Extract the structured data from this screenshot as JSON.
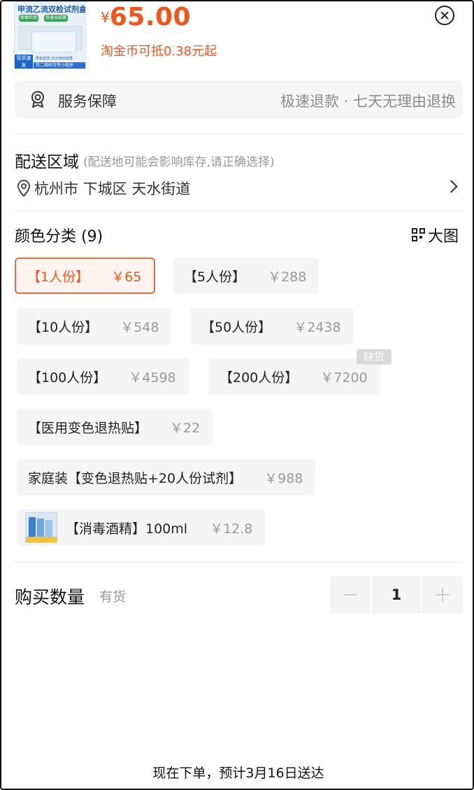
{
  "product": {
    "thumbnail_title": "甲流乙流双检试剂盒",
    "thumbnail_chips": [
      "病毒检测",
      "快速出结果"
    ],
    "thumbnail_badge": "现货速发",
    "thumbnail_strip": "带二维码可传小程序",
    "thumbnail_strip2": "居家自测 15分钟出结果",
    "currency": "¥",
    "price": "65.00",
    "coin_note": "淘金币可抵0.38元起"
  },
  "service": {
    "label": "服务保障",
    "description": "极速退款 · 七天无理由退换",
    "icon": "badge-icon"
  },
  "delivery": {
    "title": "配送区域",
    "hint": "(配送地可能会影响库存,请正确选择)",
    "address": "杭州市 下城区 天水街道",
    "icon": "location-pin-icon"
  },
  "variants": {
    "title": "颜色分类 (9)",
    "big_pic_label": "大图",
    "out_of_stock_label": "缺货",
    "options": [
      {
        "name": "【1人份】",
        "price": "￥65",
        "selected": true
      },
      {
        "name": "【5人份】",
        "price": "￥288"
      },
      {
        "name": "【10人份】",
        "price": "￥548"
      },
      {
        "name": "【50人份】",
        "price": "￥2438"
      },
      {
        "name": "【100人份】",
        "price": "￥4598"
      },
      {
        "name": "【200人份】",
        "price": "￥7200",
        "out_of_stock": true
      },
      {
        "name": "【医用变色退热贴】",
        "price": "￥22"
      },
      {
        "name": "家庭装【变色退热贴+20人份试剂】",
        "price": "￥988"
      },
      {
        "name": "【消毒酒精】100ml",
        "price": "￥12.8",
        "has_thumbnail": true
      }
    ]
  },
  "quantity": {
    "label": "购买数量",
    "stock": "有货",
    "value": "1"
  },
  "footer": {
    "delivery_estimate": "现在下单，预计3月16日送达"
  },
  "colors": {
    "accent": "#f2551b",
    "selected_border": "#f16a3b",
    "chip_bg": "#f5f5f5"
  }
}
